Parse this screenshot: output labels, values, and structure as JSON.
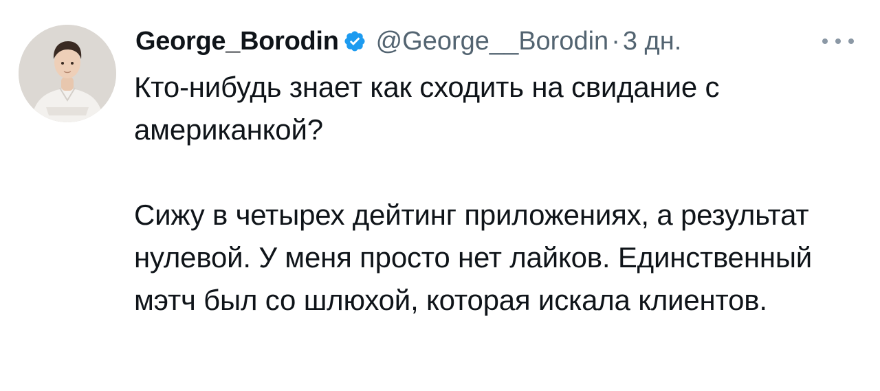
{
  "tweet": {
    "author": {
      "display_name": "George_Borodin",
      "handle": "@George__Borodin",
      "verified": true,
      "avatar_icon": "person-photo-avatar"
    },
    "time_separator": "·",
    "time": "3 дн.",
    "more_icon": "more-horizontal-icon",
    "text": {
      "paragraph_1": "Кто-нибудь знает как сходить на свидание с американкой?",
      "paragraph_2": "Сижу в четырех дейтинг приложениях, а результат нулевой. У меня просто нет лайков. Единственный мэтч был со шлюхой, которая искала клиентов."
    }
  },
  "colors": {
    "text_primary": "#0f1419",
    "text_secondary": "#536471",
    "verified_badge": "#1d9bf0",
    "background": "#ffffff"
  }
}
